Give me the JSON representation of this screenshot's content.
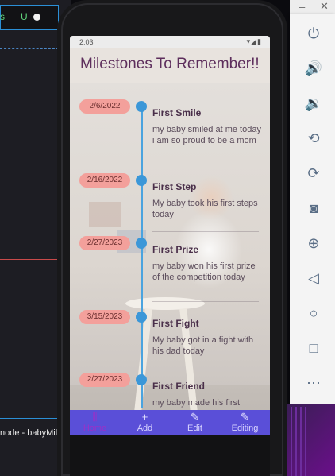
{
  "editor": {
    "tab_s": "s",
    "tab_u": "U",
    "status_text": "node - babyMil"
  },
  "statusbar": {
    "time": "2:03",
    "icons": "▾◢▮"
  },
  "app": {
    "title": "Milestones To Remember!!",
    "milestones": [
      {
        "date": "2/6/2022",
        "title": "First Smile",
        "description": "my baby smiled at me today i am so proud to be a mom"
      },
      {
        "date": "2/16/2022",
        "title": "First Step",
        "description": "My baby took his first steps today"
      },
      {
        "date": "2/27/2023",
        "title": "First Prize",
        "description": "my baby won his first prize of the competition today"
      },
      {
        "date": "3/15/2023",
        "title": "First Fight",
        "description": "My baby got in a fight with his dad today"
      },
      {
        "date": "2/27/2023",
        "title": "First Friend",
        "description": "my baby made his first"
      }
    ],
    "nav": [
      {
        "label": "Home",
        "icon": "home-icon",
        "glyph": "⫼",
        "active": true
      },
      {
        "label": "Add",
        "icon": "add-icon",
        "glyph": "+",
        "active": false
      },
      {
        "label": "Edit",
        "icon": "edit-icon",
        "glyph": "✎",
        "active": false
      },
      {
        "label": "Editing",
        "icon": "editing-icon",
        "glyph": "✎",
        "active": false
      }
    ],
    "colors": {
      "accent": "#5a4fd8",
      "date_badge": "#f3a09b",
      "timeline": "#3b97d8",
      "title": "#5d2e5c"
    }
  },
  "emulator": {
    "window_min": "–",
    "window_close": "✕",
    "controls": [
      {
        "name": "power-icon",
        "glyph": "⏻"
      },
      {
        "name": "volume-up-icon",
        "glyph": "🔊"
      },
      {
        "name": "volume-down-icon",
        "glyph": "🔉"
      },
      {
        "name": "rotate-left-icon",
        "glyph": "⟲"
      },
      {
        "name": "rotate-right-icon",
        "glyph": "⟳"
      },
      {
        "name": "camera-icon",
        "glyph": "◙"
      },
      {
        "name": "zoom-icon",
        "glyph": "⊕"
      },
      {
        "name": "back-icon",
        "glyph": "◁"
      },
      {
        "name": "home-circle-icon",
        "glyph": "○"
      },
      {
        "name": "overview-icon",
        "glyph": "□"
      },
      {
        "name": "more-icon",
        "glyph": "⋯"
      }
    ]
  }
}
